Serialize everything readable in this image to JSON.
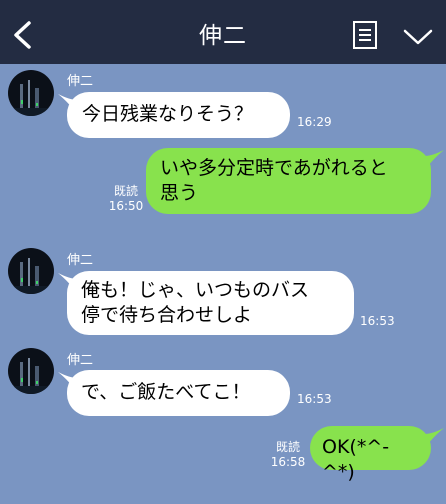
{
  "header": {
    "title": "伸二",
    "back_icon": "chevron-left-icon",
    "menu_icon": "notes-icon",
    "dropdown_icon": "chevron-down-icon"
  },
  "messages": [
    {
      "side": "left",
      "sender": "伸二",
      "lines": [
        "今日残業なりそう？"
      ],
      "time": "16:29"
    },
    {
      "side": "right",
      "lines": [
        "いや多分定時であがれると",
        "思う"
      ],
      "read": "既読",
      "time": "16:50"
    },
    {
      "side": "left",
      "sender": "伸二",
      "lines": [
        "俺も！じゃ、いつものバス",
        "停で待ち合わせしよ"
      ],
      "time": "16:53"
    },
    {
      "side": "left",
      "sender": "伸二",
      "lines": [
        "で、ご飯たべてこ！"
      ],
      "time": "16:53"
    },
    {
      "side": "right",
      "lines": [
        "OK(*^-^*)"
      ],
      "read": "既読",
      "time": "16:58"
    }
  ],
  "colors": {
    "background": "#7a95c2",
    "header": "#232c42",
    "outgoing_bubble": "#88e24d",
    "incoming_bubble": "#ffffff"
  }
}
